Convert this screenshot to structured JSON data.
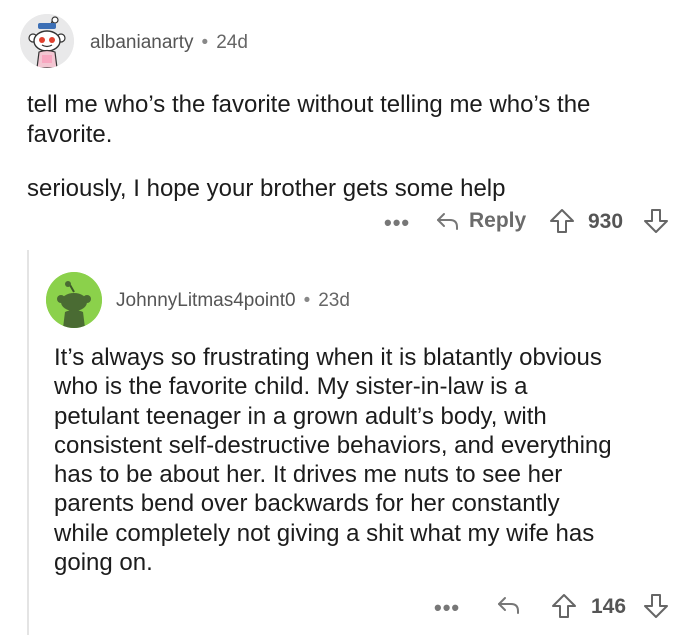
{
  "comment": {
    "username": "albanianarty",
    "separator": "•",
    "age": "24d",
    "paragraphs": [
      "tell me who’s the favorite without telling me who’s the",
      "favorite.",
      "seriously, I hope your brother gets some help"
    ],
    "more_label": "•••",
    "reply_label": "Reply",
    "votes": "930"
  },
  "reply": {
    "username": "JohnnyLitmas4point0",
    "separator": "•",
    "age": "23d",
    "lines": [
      "It’s always so frustrating when it is blatantly obvious",
      "who is the favorite child. My sister-in-law is a",
      "petulant teenager in a grown adult’s body, with",
      "consistent self-destructive behaviors, and everything",
      "has to be about her. It drives me nuts to see her",
      "parents bend over backwards for her constantly",
      "while completely not giving a shit what my wife has",
      "going on."
    ],
    "more_label": "•••",
    "votes": "146"
  },
  "colors": {
    "reply_avatar_bg": "#8bd14b",
    "thread_line": "#e4e4e4",
    "text": "#1c1c1c",
    "meta": "#666666"
  },
  "icons": [
    "snoo-avatar-icon",
    "reply-arrow-icon",
    "upvote-icon",
    "downvote-icon",
    "more-options-icon"
  ]
}
